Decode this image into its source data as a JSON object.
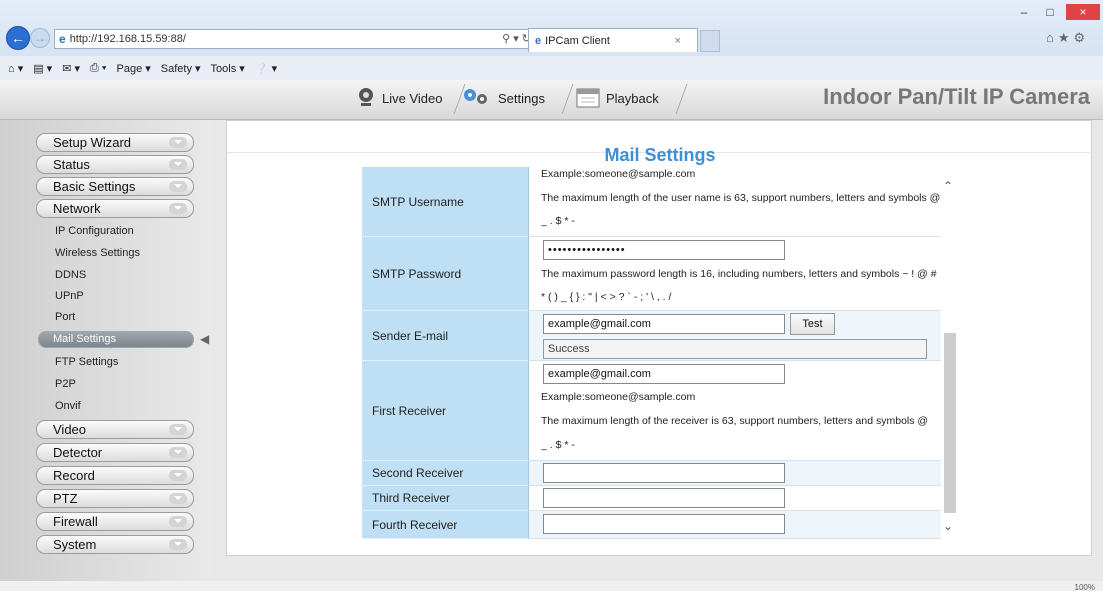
{
  "browser": {
    "url": "http://192.168.15.59:88/",
    "tab_title": "IPCam Client",
    "command_bar": [
      "Page ▾",
      "Safety ▾",
      "Tools ▾"
    ],
    "zoom": "100%"
  },
  "camera": {
    "title": "Indoor Pan/Tilt IP Camera",
    "tabs": [
      "Live Video",
      "Settings",
      "Playback"
    ]
  },
  "sidebar": {
    "menu": [
      "Setup Wizard",
      "Status",
      "Basic Settings",
      "Network",
      "Video",
      "Detector",
      "Record",
      "PTZ",
      "Firewall",
      "System"
    ],
    "network_sub": [
      "IP Configuration",
      "Wireless Settings",
      "DDNS",
      "UPnP",
      "Port",
      "Mail Settings",
      "FTP Settings",
      "P2P",
      "Onvif"
    ],
    "active": "Mail Settings"
  },
  "main": {
    "title": "Mail Settings",
    "smtp_username": {
      "label": "SMTP Username",
      "example": "Example:someone@sample.com",
      "hint_line1": "The maximum length of the user name is 63, support numbers, letters and symbols @",
      "hint_line2": "_ . $ * -"
    },
    "smtp_password": {
      "label": "SMTP Password",
      "value": "••••••••••••••••",
      "hint_line1": "The maximum password length is 16, including numbers, letters and symbols ~ ! @ #",
      "hint_line2": "* ( ) _ { } : \" | < > ? ` - ; ' \\ , . /"
    },
    "sender_email": {
      "label": "Sender E-mail",
      "value": "example@gmail.com",
      "test_button": "Test",
      "status": "Success"
    },
    "first_receiver": {
      "label": "First Receiver",
      "value": "example@gmail.com",
      "example": "Example:someone@sample.com",
      "hint_line1": "The maximum length of the receiver is 63, support numbers, letters and symbols @",
      "hint_line2": "_ . $ * -"
    },
    "second_receiver": {
      "label": "Second Receiver",
      "value": ""
    },
    "third_receiver": {
      "label": "Third Receiver",
      "value": ""
    },
    "fourth_receiver": {
      "label": "Fourth Receiver",
      "value": ""
    }
  }
}
